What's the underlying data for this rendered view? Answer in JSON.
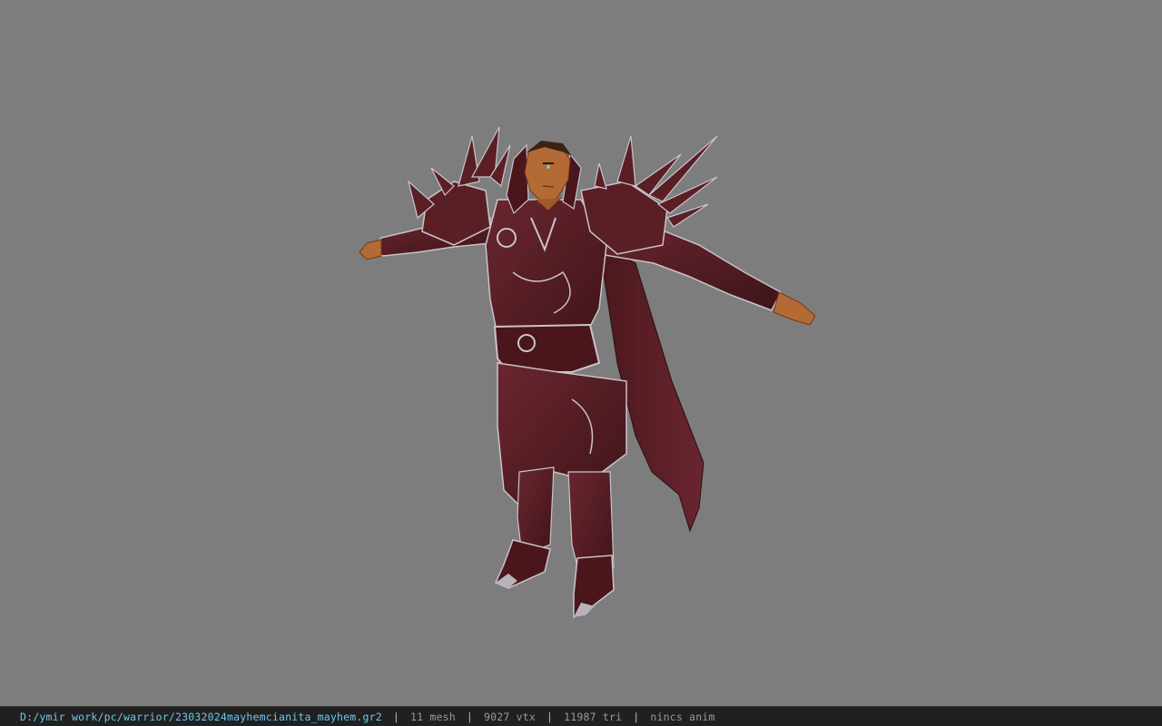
{
  "viewer": {
    "background_color": "#7d7d7d",
    "model": {
      "subject": "armored warrior character in T-pose",
      "armor_color": "#5a1f24",
      "trim_color": "#c9c3cc",
      "skin_color": "#b46a34"
    }
  },
  "status_bar": {
    "file_path": "D:/ymir work/pc/warrior/23032024mayhemcianita_mayhem.gr2",
    "separator": "|",
    "mesh_count": "11 mesh",
    "vertex_count": "9027 vtx",
    "triangle_count": "11987 tri",
    "animation": "nincs anim",
    "path_color": "#6cc7ee",
    "bar_color": "#202020"
  }
}
